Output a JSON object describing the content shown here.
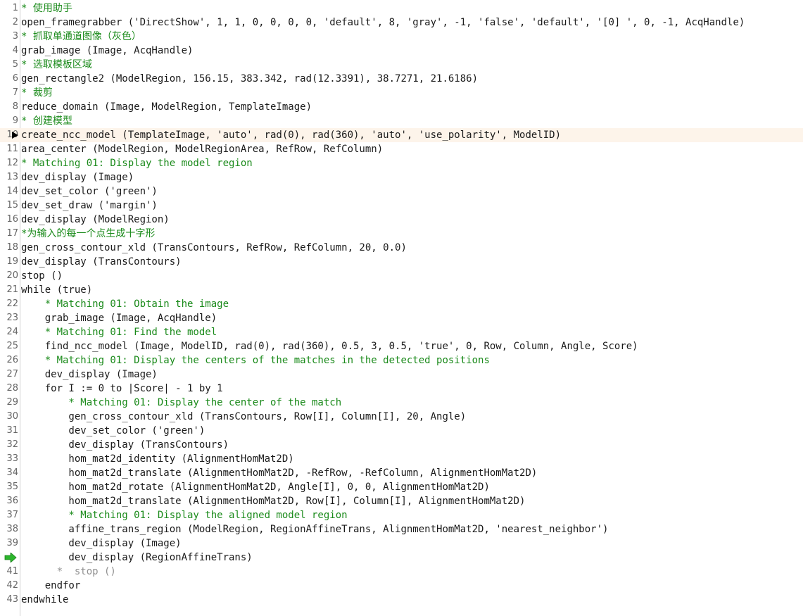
{
  "colors": {
    "comment": "#1a8a1a",
    "code": "#1a1a1a",
    "disabled": "#909090",
    "highlight": "#fdf4ea",
    "pc_arrow": "#2bb52b"
  },
  "markers": {
    "insert_cursor_line": 10,
    "program_counter_line": 40,
    "pc_icon": "green-arrow-icon",
    "cursor_icon": "black-triangle-icon"
  },
  "lines": [
    {
      "n": "1",
      "t": "* 使用助手",
      "k": "comment"
    },
    {
      "n": "2",
      "t": "open_framegrabber ('DirectShow', 1, 1, 0, 0, 0, 0, 'default', 8, 'gray', -1, 'false', 'default', '[0] ', 0, -1, AcqHandle)",
      "k": "code"
    },
    {
      "n": "3",
      "t": "* 抓取单通道图像（灰色）",
      "k": "comment"
    },
    {
      "n": "4",
      "t": "grab_image (Image, AcqHandle)",
      "k": "code"
    },
    {
      "n": "5",
      "t": "* 选取模板区域",
      "k": "comment"
    },
    {
      "n": "6",
      "t": "gen_rectangle2 (ModelRegion, 156.15, 383.342, rad(12.3391), 38.7271, 21.6186)",
      "k": "code"
    },
    {
      "n": "7",
      "t": "* 裁剪",
      "k": "comment"
    },
    {
      "n": "8",
      "t": "reduce_domain (Image, ModelRegion, TemplateImage)",
      "k": "code"
    },
    {
      "n": "9",
      "t": "* 创建模型",
      "k": "comment"
    },
    {
      "n": "10",
      "t": "create_ncc_model (TemplateImage, 'auto', rad(0), rad(360), 'auto', 'use_polarity', ModelID)",
      "k": "code"
    },
    {
      "n": "11",
      "t": "area_center (ModelRegion, ModelRegionArea, RefRow, RefColumn)",
      "k": "code"
    },
    {
      "n": "12",
      "t": "* Matching 01: Display the model region",
      "k": "comment"
    },
    {
      "n": "13",
      "t": "dev_display (Image)",
      "k": "code"
    },
    {
      "n": "14",
      "t": "dev_set_color ('green')",
      "k": "code"
    },
    {
      "n": "15",
      "t": "dev_set_draw ('margin')",
      "k": "code"
    },
    {
      "n": "16",
      "t": "dev_display (ModelRegion)",
      "k": "code"
    },
    {
      "n": "17",
      "t": "*为输入的每一个点生成十字形",
      "k": "comment"
    },
    {
      "n": "18",
      "t": "gen_cross_contour_xld (TransContours, RefRow, RefColumn, 20, 0.0)",
      "k": "code"
    },
    {
      "n": "19",
      "t": "dev_display (TransContours)",
      "k": "code"
    },
    {
      "n": "20",
      "t": "stop ()",
      "k": "code"
    },
    {
      "n": "21",
      "t": "while (true)",
      "k": "code"
    },
    {
      "n": "22",
      "t": "    * Matching 01: Obtain the image",
      "k": "comment"
    },
    {
      "n": "23",
      "t": "    grab_image (Image, AcqHandle)",
      "k": "code"
    },
    {
      "n": "24",
      "t": "    * Matching 01: Find the model",
      "k": "comment"
    },
    {
      "n": "25",
      "t": "    find_ncc_model (Image, ModelID, rad(0), rad(360), 0.5, 3, 0.5, 'true', 0, Row, Column, Angle, Score)",
      "k": "code"
    },
    {
      "n": "26",
      "t": "    * Matching 01: Display the centers of the matches in the detected positions",
      "k": "comment"
    },
    {
      "n": "27",
      "t": "    dev_display (Image)",
      "k": "code"
    },
    {
      "n": "28",
      "t": "    for I := 0 to |Score| - 1 by 1",
      "k": "code"
    },
    {
      "n": "29",
      "t": "        * Matching 01: Display the center of the match",
      "k": "comment"
    },
    {
      "n": "30",
      "t": "        gen_cross_contour_xld (TransContours, Row[I], Column[I], 20, Angle)",
      "k": "code"
    },
    {
      "n": "31",
      "t": "        dev_set_color ('green')",
      "k": "code"
    },
    {
      "n": "32",
      "t": "        dev_display (TransContours)",
      "k": "code"
    },
    {
      "n": "33",
      "t": "        hom_mat2d_identity (AlignmentHomMat2D)",
      "k": "code"
    },
    {
      "n": "34",
      "t": "        hom_mat2d_translate (AlignmentHomMat2D, -RefRow, -RefColumn, AlignmentHomMat2D)",
      "k": "code"
    },
    {
      "n": "35",
      "t": "        hom_mat2d_rotate (AlignmentHomMat2D, Angle[I], 0, 0, AlignmentHomMat2D)",
      "k": "code"
    },
    {
      "n": "36",
      "t": "        hom_mat2d_translate (AlignmentHomMat2D, Row[I], Column[I], AlignmentHomMat2D)",
      "k": "code"
    },
    {
      "n": "37",
      "t": "        * Matching 01: Display the aligned model region",
      "k": "comment"
    },
    {
      "n": "38",
      "t": "        affine_trans_region (ModelRegion, RegionAffineTrans, AlignmentHomMat2D, 'nearest_neighbor')",
      "k": "code"
    },
    {
      "n": "39",
      "t": "        dev_display (Image)",
      "k": "code"
    },
    {
      "n": "40",
      "t": "        dev_display (RegionAffineTrans)",
      "k": "code"
    },
    {
      "n": "41",
      "t": "      *  stop ()",
      "k": "disabled"
    },
    {
      "n": "42",
      "t": "    endfor",
      "k": "code"
    },
    {
      "n": "43",
      "t": "endwhile",
      "k": "code"
    }
  ]
}
